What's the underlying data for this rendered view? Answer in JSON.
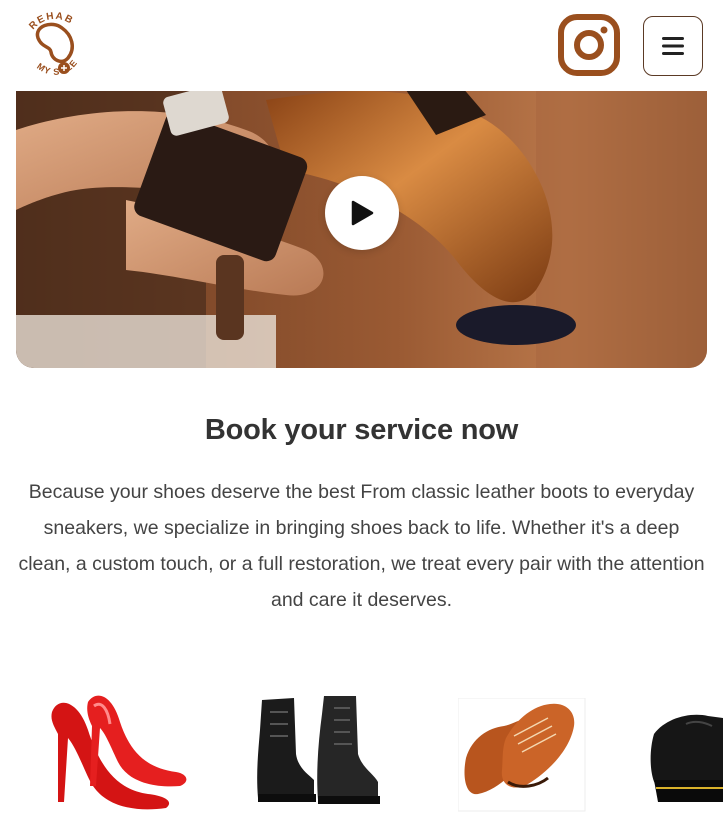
{
  "header": {
    "logo_text_top": "REHAB",
    "logo_text_bottom": "MY SOLE",
    "instagram_icon": "instagram-icon",
    "menu_icon": "hamburger-menu-icon"
  },
  "video": {
    "play_icon": "play-icon"
  },
  "section": {
    "title": "Book your service now",
    "description": "Because your shoes deserve the best From classic leather boots to everyday sneakers, we specialize in bringing shoes back to life. Whether it's a deep clean, a custom touch, or a full restoration, we treat every pair with the attention and care it deserves."
  },
  "products": [
    {
      "name": "red-high-heels"
    },
    {
      "name": "black-combat-boots"
    },
    {
      "name": "brown-leather-oxfords"
    },
    {
      "name": "black-platform-shoes"
    }
  ],
  "colors": {
    "brand_brown": "#9a4f1e",
    "menu_border": "#5b3a25",
    "title_text": "#333333"
  }
}
